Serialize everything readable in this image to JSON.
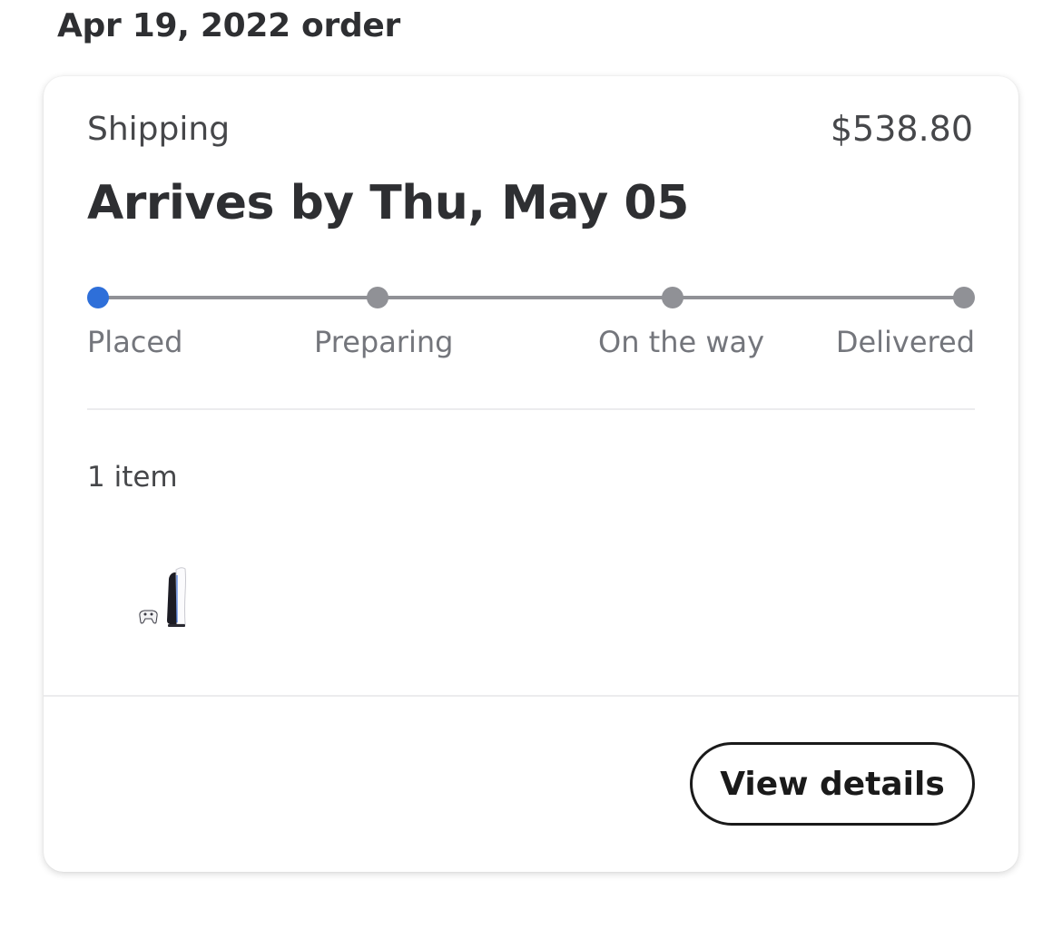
{
  "header": {
    "order_date": "Apr 19, 2022 order"
  },
  "card": {
    "status": "Shipping",
    "total": "$538.80",
    "arrival": "Arrives by Thu, May 05",
    "tracker": {
      "current_step": 0,
      "steps": [
        {
          "label": "Placed"
        },
        {
          "label": "Preparing"
        },
        {
          "label": "On the way"
        },
        {
          "label": "Delivered"
        }
      ]
    },
    "item_count": "1 item",
    "item_icon": "ps5-console-product-image",
    "view_details_label": "View details"
  },
  "colors": {
    "progress_active": "#2e6fd9",
    "progress_inactive": "#909196",
    "text_primary": "#2e2f32",
    "text_secondary": "#74767c"
  }
}
